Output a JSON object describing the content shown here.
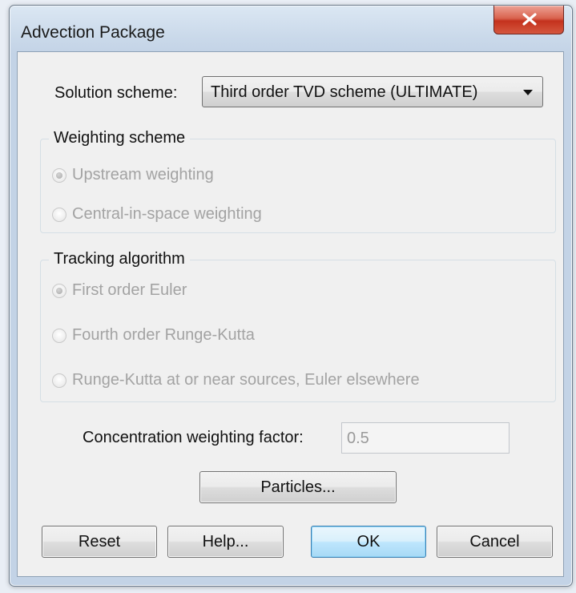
{
  "window": {
    "title": "Advection Package",
    "close_glyph": "x"
  },
  "solution": {
    "label": "Solution scheme:",
    "selected": "Third order TVD scheme (ULTIMATE)"
  },
  "weighting": {
    "title": "Weighting scheme",
    "options": [
      {
        "label": "Upstream weighting",
        "checked": true,
        "enabled": false
      },
      {
        "label": "Central-in-space weighting",
        "checked": false,
        "enabled": false
      }
    ]
  },
  "tracking": {
    "title": "Tracking algorithm",
    "options": [
      {
        "label": "First order Euler",
        "checked": true,
        "enabled": false
      },
      {
        "label": "Fourth order Runge-Kutta",
        "checked": false,
        "enabled": false
      },
      {
        "label": "Runge-Kutta at or near sources, Euler elsewhere",
        "checked": false,
        "enabled": false
      }
    ]
  },
  "concentration": {
    "label": "Concentration weighting factor:",
    "value": "0.5"
  },
  "buttons": {
    "particles": "Particles...",
    "reset": "Reset",
    "help": "Help...",
    "ok": "OK",
    "cancel": "Cancel"
  },
  "colors": {
    "title_bar": "#c3d3e6",
    "close_button": "#c4321d",
    "client_bg": "#f0f0f0",
    "disabled_text": "#a3a3a3",
    "default_button_border": "#3c7fb1"
  },
  "icons": {
    "close": "close-icon",
    "dropdown": "chevron-down-icon"
  }
}
